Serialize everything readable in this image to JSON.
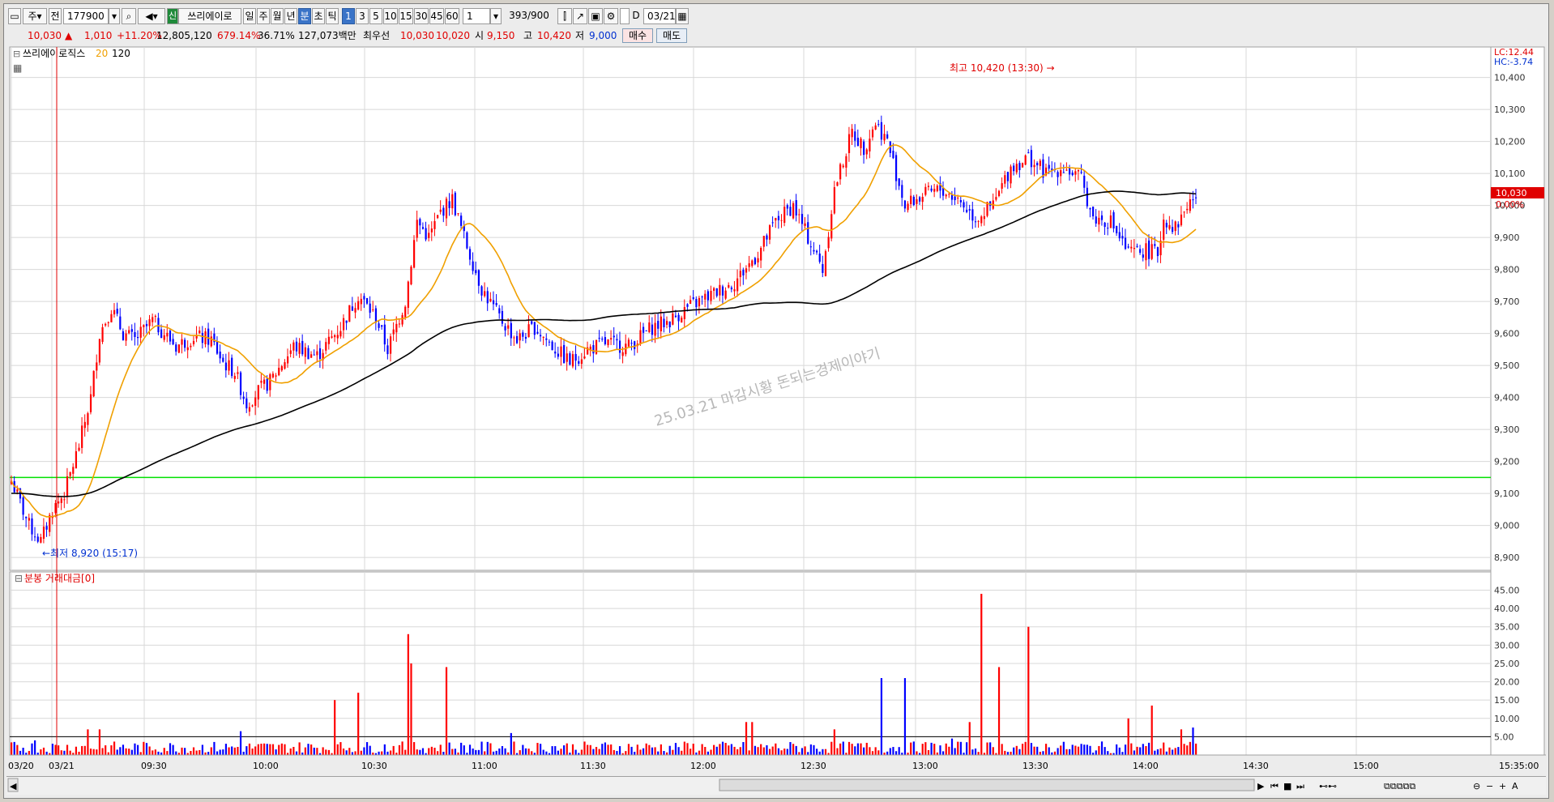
{
  "toolbar": {
    "menu_label": "주",
    "prev_label": "전",
    "code": "177900",
    "brand_tag": "신",
    "stock_name": "쓰리에이로",
    "periods": [
      "일",
      "주",
      "월",
      "년",
      "분",
      "초",
      "틱"
    ],
    "selected_period": "분",
    "intervals": [
      "1",
      "3",
      "5",
      "10",
      "15",
      "30",
      "45",
      "60"
    ],
    "selected_interval": "1",
    "count_value": "1",
    "range_text": "393/900",
    "d_label": "D",
    "date_value": "03/21"
  },
  "quote": {
    "price": "10,030",
    "arrow": "▲",
    "change": "1,010",
    "change_pct": "+11.20%",
    "volume": "12,805,120",
    "vol_pct": "679.14%",
    "turnover": "36.71%",
    "amount": "127,073백만",
    "ask_label": "최우선",
    "ask": "10,030",
    "bid": "10,020",
    "open_label": "시",
    "open": "9,150",
    "high_label": "고",
    "high": "10,420",
    "low_label": "저",
    "low": "9,000",
    "buy_button": "매수",
    "sell_button": "매도"
  },
  "chart_data": {
    "type": "candlestick",
    "legend": {
      "name": "쓰리에이로직스",
      "ma_short": "20",
      "ma_long": "120"
    },
    "colors": {
      "up": "#ff0000",
      "down": "#0000ff",
      "ma_short": "#f0a000",
      "ma_long": "#000000",
      "hline": "#00e000",
      "grid": "#d8d8d8"
    },
    "y_ticks": [
      "10,400",
      "10,300",
      "10,200",
      "10,100",
      "10,000",
      "9,900",
      "9,800",
      "9,700",
      "9,600",
      "9,500",
      "9,400",
      "9,300",
      "9,200",
      "9,100",
      "9,000",
      "8,900"
    ],
    "y_range": [
      8880,
      10480
    ],
    "x_ticks": [
      "03/20",
      "03/21",
      "09:30",
      "10:00",
      "10:30",
      "11:00",
      "11:30",
      "12:00",
      "12:30",
      "13:00",
      "13:30",
      "14:00",
      "14:30",
      "15:00",
      "15:35:00"
    ],
    "horizontal_line": 9150,
    "last_price_label": "10,030",
    "last_pct_label": "0.00%",
    "lc_label": "LC:12.44",
    "hc_label": "HC:-3.74",
    "high_annotation": "최고 10,420 (13:30) →",
    "low_annotation": "←최저 8,920 (15:17)",
    "watermark": "25.03.21 마감시황 돈되는경제이야기",
    "anchors": [
      [
        0,
        9140
      ],
      [
        6,
        9000
      ],
      [
        10,
        8950
      ],
      [
        14,
        9050
      ],
      [
        18,
        9100
      ],
      [
        23,
        9250
      ],
      [
        27,
        9400
      ],
      [
        30,
        9600
      ],
      [
        34,
        9680
      ],
      [
        38,
        9600
      ],
      [
        42,
        9580
      ],
      [
        48,
        9640
      ],
      [
        56,
        9560
      ],
      [
        62,
        9590
      ],
      [
        68,
        9580
      ],
      [
        72,
        9510
      ],
      [
        76,
        9480
      ],
      [
        80,
        9380
      ],
      [
        84,
        9420
      ],
      [
        88,
        9450
      ],
      [
        96,
        9560
      ],
      [
        104,
        9530
      ],
      [
        112,
        9620
      ],
      [
        118,
        9720
      ],
      [
        124,
        9650
      ],
      [
        128,
        9550
      ],
      [
        134,
        9700
      ],
      [
        138,
        9950
      ],
      [
        142,
        9900
      ],
      [
        146,
        9980
      ],
      [
        150,
        10020
      ],
      [
        154,
        9900
      ],
      [
        160,
        9740
      ],
      [
        166,
        9650
      ],
      [
        172,
        9580
      ],
      [
        178,
        9620
      ],
      [
        184,
        9560
      ],
      [
        190,
        9510
      ],
      [
        196,
        9550
      ],
      [
        202,
        9570
      ],
      [
        210,
        9560
      ],
      [
        218,
        9620
      ],
      [
        224,
        9640
      ],
      [
        230,
        9680
      ],
      [
        238,
        9720
      ],
      [
        246,
        9760
      ],
      [
        254,
        9850
      ],
      [
        260,
        9950
      ],
      [
        266,
        10000
      ],
      [
        272,
        9880
      ],
      [
        276,
        9800
      ],
      [
        280,
        10050
      ],
      [
        286,
        10230
      ],
      [
        290,
        10180
      ],
      [
        294,
        10260
      ],
      [
        298,
        10200
      ],
      [
        304,
        10000
      ],
      [
        310,
        10030
      ],
      [
        316,
        10050
      ],
      [
        322,
        10020
      ],
      [
        328,
        9960
      ],
      [
        334,
        10000
      ],
      [
        340,
        10120
      ],
      [
        346,
        10150
      ],
      [
        352,
        10100
      ],
      [
        358,
        10120
      ],
      [
        364,
        10080
      ],
      [
        368,
        9960
      ],
      [
        374,
        9950
      ],
      [
        380,
        9850
      ],
      [
        386,
        9860
      ],
      [
        390,
        9850
      ],
      [
        392,
        9960
      ],
      [
        396,
        9930
      ],
      [
        400,
        10000
      ],
      [
        403,
        10030
      ]
    ],
    "volume": {
      "label": "분봉 거래대금[0]",
      "y_ticks": [
        "45.00",
        "40.00",
        "35.00",
        "30.00",
        "25.00",
        "20.00",
        "15.00",
        "10.00",
        "5.00"
      ],
      "y_range": [
        0,
        46
      ],
      "ref_line": 5,
      "spikes": [
        [
          8,
          4
        ],
        [
          26,
          7
        ],
        [
          30,
          7
        ],
        [
          78,
          6.5
        ],
        [
          110,
          15
        ],
        [
          118,
          17
        ],
        [
          135,
          33
        ],
        [
          136,
          25
        ],
        [
          148,
          24
        ],
        [
          170,
          6
        ],
        [
          250,
          9
        ],
        [
          252,
          9
        ],
        [
          280,
          7
        ],
        [
          296,
          21
        ],
        [
          304,
          21
        ],
        [
          320,
          4.5
        ],
        [
          326,
          9
        ],
        [
          330,
          44
        ],
        [
          336,
          24
        ],
        [
          346,
          35
        ],
        [
          380,
          10
        ],
        [
          388,
          13.5
        ],
        [
          398,
          7
        ],
        [
          402,
          7.5
        ]
      ]
    }
  }
}
